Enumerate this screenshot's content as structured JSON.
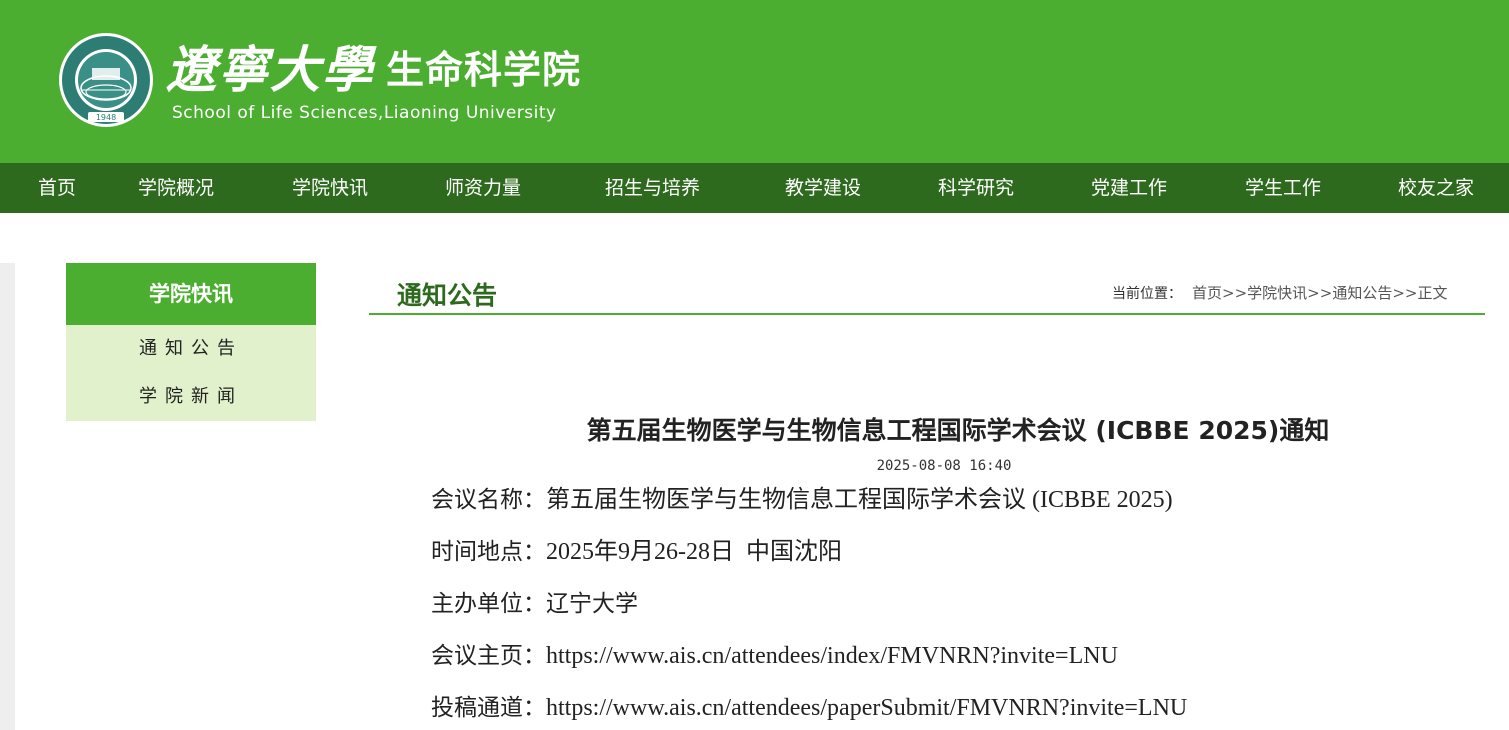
{
  "header": {
    "university_name": "遼寧大學",
    "school_name": "生命科学院",
    "school_name_en": "School of Life Sciences,Liaoning University",
    "colors": {
      "header_green": "#4cae31",
      "nav_green": "#2e6a1e",
      "side_bg": "#e1f1cb"
    },
    "logo_icon": "university-seal-icon"
  },
  "nav": {
    "items": [
      {
        "label": "首页"
      },
      {
        "label": "学院概况"
      },
      {
        "label": "学院快讯"
      },
      {
        "label": "师资力量"
      },
      {
        "label": "招生与培养"
      },
      {
        "label": "教学建设"
      },
      {
        "label": "科学研究"
      },
      {
        "label": "党建工作"
      },
      {
        "label": "学生工作"
      },
      {
        "label": "校友之家"
      }
    ]
  },
  "sidebar": {
    "title": "学院快讯",
    "items": [
      {
        "label": "通知公告"
      },
      {
        "label": "学院新闻"
      }
    ]
  },
  "section": {
    "title": "通知公告",
    "breadcrumb_label": "当前位置：",
    "breadcrumb": [
      "首页",
      "学院快讯",
      "通知公告",
      "正文"
    ],
    "breadcrumb_sep": ">>"
  },
  "article": {
    "title": "第五届生物医学与生物信息工程国际学术会议 (ICBBE 2025)通知",
    "date": "2025-08-08 16:40",
    "rows": [
      {
        "label": "会议名称：",
        "value": "第五届生物医学与生物信息工程国际学术会议 (ICBBE 2025)"
      },
      {
        "label": "时间地点：",
        "value": "2025年9月26-28日  中国沈阳"
      },
      {
        "label": "主办单位：",
        "value": "辽宁大学"
      },
      {
        "label": "会议主页：",
        "value": "https://www.ais.cn/attendees/index/FMVNRN?invite=LNU"
      },
      {
        "label": "投稿通道：",
        "value": "https://www.ais.cn/attendees/paperSubmit/FMVNRN?invite=LNU"
      }
    ]
  }
}
